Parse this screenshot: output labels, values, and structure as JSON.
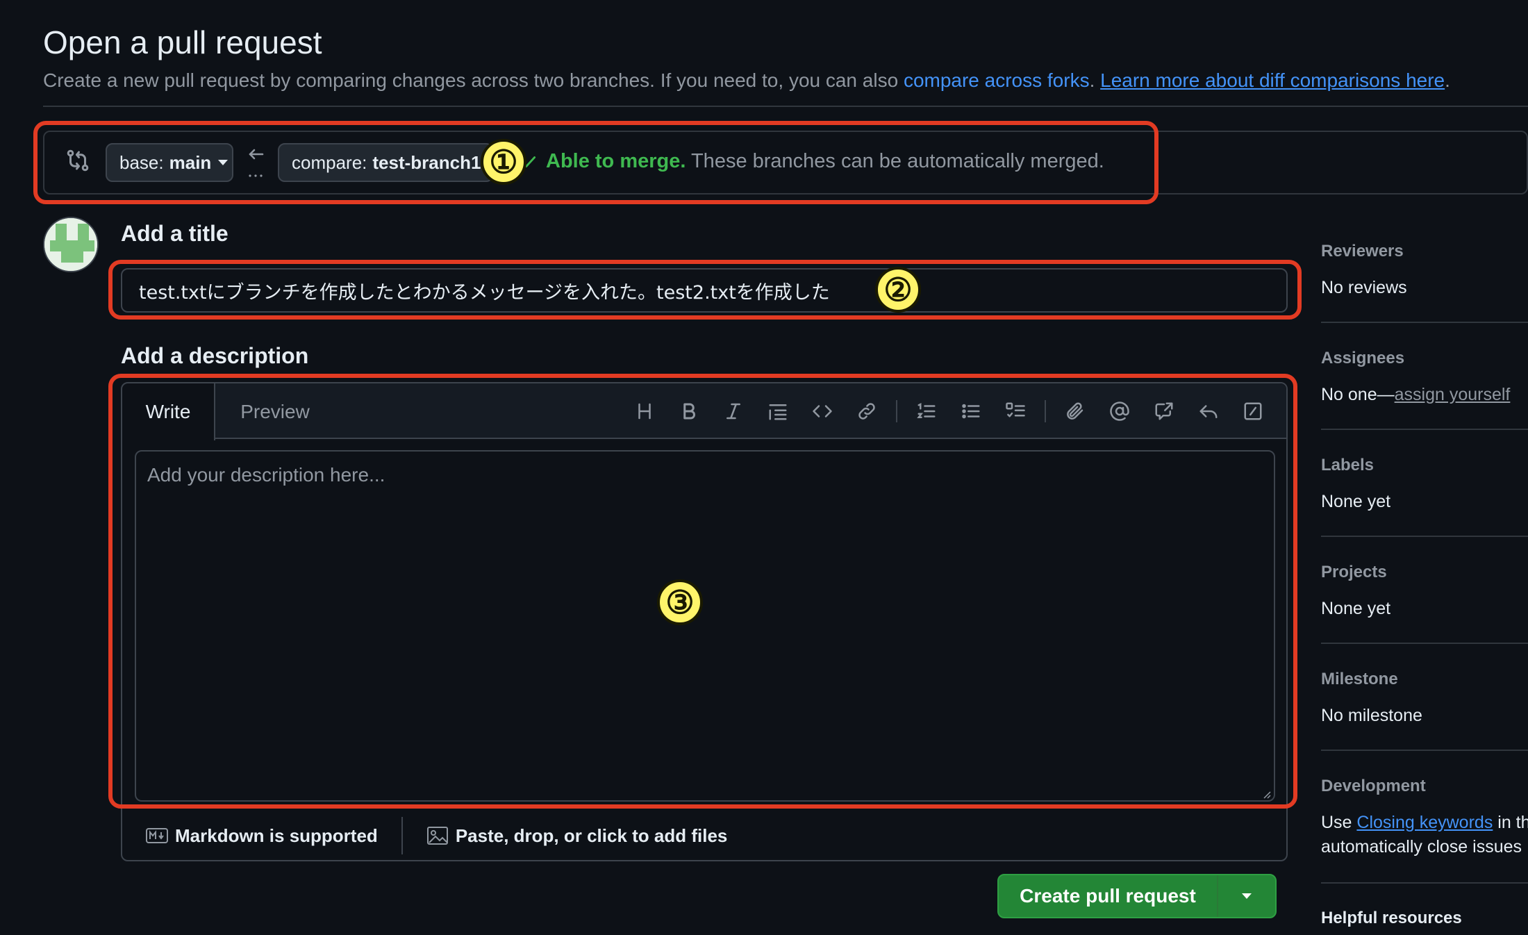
{
  "header": {
    "title": "Open a pull request",
    "subtitle_prefix": "Create a new pull request by comparing changes across two branches. If you need to, you can also ",
    "compare_forks_link": "compare across forks",
    "subtitle_mid": ". ",
    "learn_more_link": "Learn more about diff comparisons here",
    "subtitle_end": "."
  },
  "compare_bar": {
    "base_prefix": "base:",
    "base_branch": "main",
    "compare_prefix": "compare:",
    "compare_branch": "test-branch1",
    "status_ok": "Able to merge.",
    "status_text": " These branches can be automatically merged."
  },
  "title_section": {
    "label": "Add a title",
    "value": "test.txtにブランチを作成したとわかるメッセージを入れた。test2.txtを作成した"
  },
  "description_section": {
    "label": "Add a description",
    "tabs": {
      "write": "Write",
      "preview": "Preview"
    },
    "toolbar": {
      "heading": "heading-icon",
      "bold": "bold-icon",
      "italic": "italic-icon",
      "quote": "quote-icon",
      "code": "code-icon",
      "link": "link-icon",
      "ordered_list": "ordered-list-icon",
      "unordered_list": "unordered-list-icon",
      "task_list": "task-list-icon",
      "attach": "paperclip-icon",
      "mention": "mention-icon",
      "reference": "cross-reference-icon",
      "reply": "reply-icon",
      "slash": "slash-command-icon"
    },
    "placeholder": "Add your description here...",
    "markdown_note": "Markdown is supported",
    "files_note": "Paste, drop, or click to add files"
  },
  "create_button": {
    "label": "Create pull request"
  },
  "sidebar": {
    "reviewers": {
      "title": "Reviewers",
      "value": "No reviews"
    },
    "assignees": {
      "title": "Assignees",
      "value_prefix": "No one—",
      "link": "assign yourself"
    },
    "labels": {
      "title": "Labels",
      "value": "None yet"
    },
    "projects": {
      "title": "Projects",
      "value": "None yet"
    },
    "milestone": {
      "title": "Milestone",
      "value": "No milestone"
    },
    "development": {
      "title": "Development",
      "line1_prefix": "Use ",
      "line1_link": "Closing keywords",
      "line1_suffix": " in th",
      "line2": "automatically close issues"
    },
    "helpful": {
      "title": "Helpful resources"
    }
  },
  "annotations": {
    "one": "①",
    "two": "②",
    "three": "③"
  },
  "colors": {
    "background": "#0d1117",
    "border": "#3d444d",
    "link": "#4493f8",
    "success": "#3fb950",
    "button_green": "#238636",
    "annotation_red": "#e23b23",
    "annotation_yellow": "#fff46a"
  }
}
